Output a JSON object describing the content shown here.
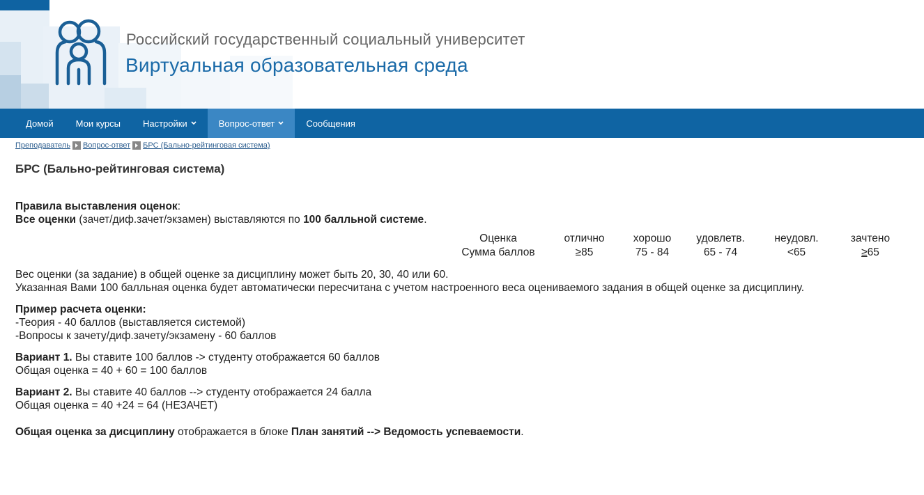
{
  "header": {
    "university": "Российский государственный социальный университет",
    "environment": "Виртуальная образовательная среда"
  },
  "nav": [
    {
      "label": "Домой",
      "dropdown": false,
      "active": false
    },
    {
      "label": "Мои курсы",
      "dropdown": false,
      "active": false
    },
    {
      "label": "Настройки",
      "dropdown": true,
      "active": false
    },
    {
      "label": "Вопрос-ответ",
      "dropdown": true,
      "active": true
    },
    {
      "label": "Сообщения",
      "dropdown": false,
      "active": false
    }
  ],
  "breadcrumb": [
    "Преподаватель",
    "Вопрос-ответ",
    "БРС (Бально-рейтинговая система)"
  ],
  "page_title": "БРС (Бально-рейтинговая система)",
  "rules": {
    "heading": "Правила выставления оценок",
    "colon": ":",
    "all_grades": "Все оценки",
    "all_grades_mid": " (зачет/диф.зачет/экзамен) выставляются по ",
    "system": "100 балльной системе",
    "period": "."
  },
  "grade_table": {
    "row1": [
      "Оценка",
      "отлично",
      "хорошо",
      "удовлетв.",
      "неудовл.",
      "зачтено"
    ],
    "row2_label": "Сумма баллов",
    "row2": [
      "≥85",
      "75 - 84",
      "65 - 74",
      "<65"
    ],
    "row2_last_symbol": "≥",
    "row2_last_value": "65"
  },
  "weight": {
    "line1": "Вес оценки (за задание) в общей оценке за дисциплину может быть 20, 30, 40 или 60.",
    "line2": "Указанная Вами 100 балльная оценка будет автоматически пересчитана с учетом настроенного веса оцениваемого задания в общей оценке за дисциплину."
  },
  "example": {
    "heading": "Пример расчета оценки:",
    "line1": "-Теория - 40 баллов (выставляется системой)",
    "line2": "-Вопросы к зачету/диф.зачету/экзамену - 60 баллов"
  },
  "variant1": {
    "label": "Вариант 1.",
    "text": " Вы ставите 100 баллов -> студенту отображается 60 баллов",
    "total": "Общая оценка = 40 + 60 = 100 баллов"
  },
  "variant2": {
    "label": "Вариант 2.",
    "text": " Вы ставите 40 баллов --> студенту отображается 24 балла",
    "total": "Общая оценка = 40 +24 = 64 (НЕЗАЧЕТ)"
  },
  "summary": {
    "bold1": "Общая оценка за дисциплину",
    "mid": " отображается в блоке ",
    "bold2": "План занятий --> Ведомость успеваемости",
    "end": "."
  },
  "colors": {
    "nav": "#0f64a3",
    "nav_active": "#3b87c4",
    "brand_blue": "#1a6aa8"
  }
}
